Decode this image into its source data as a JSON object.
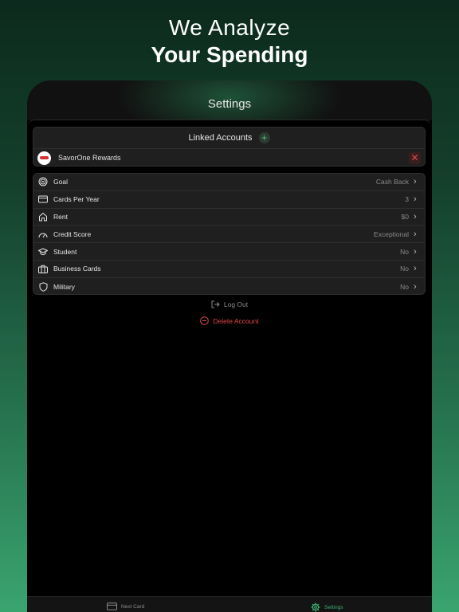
{
  "headline": {
    "line1": "We Analyze",
    "line2": "Your Spending"
  },
  "screen": {
    "title": "Settings",
    "linked_accounts": {
      "header": "Linked Accounts",
      "add_icon": "plus-icon",
      "accounts": [
        {
          "name": "SavorOne Rewards",
          "remove_icon": "close-icon"
        }
      ]
    },
    "preferences": [
      {
        "icon": "target-icon",
        "label": "Goal",
        "value": "Cash Back"
      },
      {
        "icon": "credit-card-icon",
        "label": "Cards Per Year",
        "value": "3"
      },
      {
        "icon": "house-icon",
        "label": "Rent",
        "value": "$0"
      },
      {
        "icon": "gauge-icon",
        "label": "Credit Score",
        "value": "Exceptional"
      },
      {
        "icon": "graduation-cap-icon",
        "label": "Student",
        "value": "No"
      },
      {
        "icon": "briefcase-icon",
        "label": "Business Cards",
        "value": "No"
      },
      {
        "icon": "shield-icon",
        "label": "Military",
        "value": "No"
      }
    ],
    "logout_label": "Log Out",
    "delete_label": "Delete Account"
  },
  "tabbar": {
    "items": [
      {
        "label": "Next Card",
        "icon": "credit-card-icon",
        "active": false
      },
      {
        "label": "Settings",
        "icon": "gear-icon",
        "active": true
      }
    ]
  },
  "colors": {
    "accent": "#3fb574",
    "danger": "#e04848",
    "background_top": "#0c2a1d",
    "background_bottom": "#3aa46f"
  }
}
